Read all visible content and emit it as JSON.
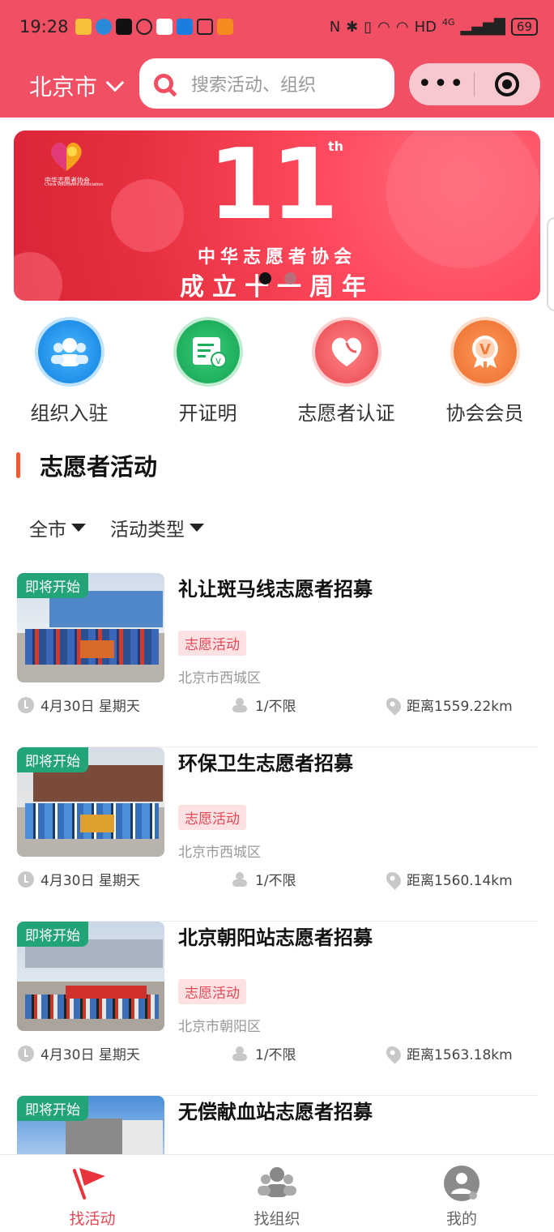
{
  "status_bar": {
    "time": "19:28",
    "network": "HD",
    "signal": "4G",
    "battery": "69"
  },
  "header": {
    "city": "北京市",
    "search_placeholder": "搜索活动、组织",
    "more": "•••"
  },
  "banner": {
    "number": "11",
    "superscript": "th",
    "logo_text": "中华志愿者协会",
    "logo_subtext": "China Volunteers Association",
    "subtitle": "中华志愿者协会",
    "headline": "成立十一周年",
    "slide_index": 1,
    "slide_count": 2
  },
  "quick_actions": [
    {
      "label": "组织入驻",
      "icon": "people-icon",
      "color": "#1f8fe8"
    },
    {
      "label": "开证明",
      "icon": "certificate-icon",
      "color": "#1fae5e"
    },
    {
      "label": "志愿者认证",
      "icon": "heart-icon",
      "color": "#f05a5f"
    },
    {
      "label": "协会会员",
      "icon": "member-badge-icon",
      "color": "#f07a3a"
    }
  ],
  "section": {
    "title": "志愿者活动"
  },
  "filters": [
    {
      "label": "全市"
    },
    {
      "label": "活动类型"
    }
  ],
  "activities": [
    {
      "badge": "即将开始",
      "title": "礼让斑马线志愿者招募",
      "tag": "志愿活动",
      "location": "北京市西城区",
      "date": "4月30日 星期天",
      "participants": "1/不限",
      "distance": "距离1559.22km"
    },
    {
      "badge": "即将开始",
      "title": "环保卫生志愿者招募",
      "tag": "志愿活动",
      "location": "北京市西城区",
      "date": "4月30日 星期天",
      "participants": "1/不限",
      "distance": "距离1560.14km"
    },
    {
      "badge": "即将开始",
      "title": "北京朝阳站志愿者招募",
      "tag": "志愿活动",
      "location": "北京市朝阳区",
      "date": "4月30日 星期天",
      "participants": "1/不限",
      "distance": "距离1563.18km"
    },
    {
      "badge": "即将开始",
      "title": "无偿献血站志愿者招募"
    }
  ],
  "tabbar": [
    {
      "label": "找活动",
      "icon": "flag-icon",
      "active": true
    },
    {
      "label": "找组织",
      "icon": "group-icon",
      "active": false
    },
    {
      "label": "我的",
      "icon": "user-icon",
      "active": false
    }
  ]
}
